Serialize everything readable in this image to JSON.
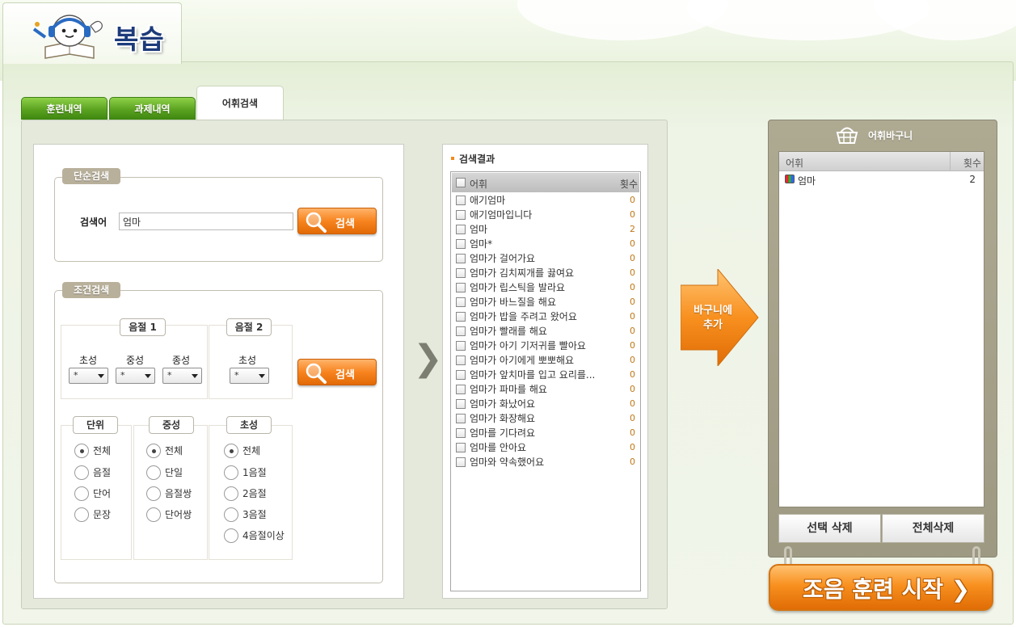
{
  "header": {
    "title": "복습"
  },
  "tabs": [
    {
      "label": "훈련내역",
      "active": false
    },
    {
      "label": "과제내역",
      "active": false
    },
    {
      "label": "어휘검색",
      "active": true
    }
  ],
  "simple_search": {
    "legend": "단순검색",
    "field_label": "검색어",
    "field_value": "엄마",
    "button_label": "검색"
  },
  "condition_search": {
    "legend": "조건검색",
    "syllable1": {
      "label": "음절 1",
      "selects": [
        {
          "label": "초성",
          "value": "*"
        },
        {
          "label": "중성",
          "value": "*"
        },
        {
          "label": "종성",
          "value": "*"
        }
      ]
    },
    "syllable2": {
      "label": "음절 2",
      "selects": [
        {
          "label": "초성",
          "value": "*"
        }
      ]
    },
    "button_label": "검색",
    "unit": {
      "label": "단위",
      "options": [
        "전체",
        "음절",
        "단어",
        "문장"
      ],
      "selected": "전체"
    },
    "middle": {
      "label": "중성",
      "options": [
        "전체",
        "단일",
        "음절쌍",
        "단어쌍"
      ],
      "selected": "전체"
    },
    "initial": {
      "label": "초성",
      "options": [
        "전체",
        "1음절",
        "2음절",
        "3음절",
        "4음절이상"
      ],
      "selected": "전체"
    }
  },
  "results": {
    "title": "검색결과",
    "col_word": "어휘",
    "col_count": "횟수",
    "rows": [
      {
        "word": "애기엄마",
        "count": "0"
      },
      {
        "word": "애기엄마입니다",
        "count": "0"
      },
      {
        "word": "엄마",
        "count": "2"
      },
      {
        "word": "엄마*",
        "count": "0"
      },
      {
        "word": "엄마가 걸어가요",
        "count": "0"
      },
      {
        "word": "엄마가 김치찌개를 끓여요",
        "count": "0"
      },
      {
        "word": "엄마가 립스틱을 발라요",
        "count": "0"
      },
      {
        "word": "엄마가 바느질을 해요",
        "count": "0"
      },
      {
        "word": "엄마가 밥을 주려고 왔어요",
        "count": "0"
      },
      {
        "word": "엄마가 빨래를 해요",
        "count": "0"
      },
      {
        "word": "엄마가 아기 기저귀를 빨아요",
        "count": "0"
      },
      {
        "word": "엄마가 아기에게 뽀뽀해요",
        "count": "0"
      },
      {
        "word": "엄마가 앞치마를 입고 요리를...",
        "count": "0"
      },
      {
        "word": "엄마가 파마를 해요",
        "count": "0"
      },
      {
        "word": "엄마가 화났어요",
        "count": "0"
      },
      {
        "word": "엄마가 화장해요",
        "count": "0"
      },
      {
        "word": "엄마를 기다려요",
        "count": "0"
      },
      {
        "word": "엄마를 안아요",
        "count": "0"
      },
      {
        "word": "엄마와 약속했어요",
        "count": "0"
      }
    ]
  },
  "add_button": {
    "line1": "바구니에",
    "line2": "추가"
  },
  "basket": {
    "title": "어휘바구니",
    "col_word": "어휘",
    "col_count": "횟수",
    "items": [
      {
        "word": "엄마",
        "count": "2"
      }
    ],
    "delete_selected": "선택 삭제",
    "delete_all": "전체삭제"
  },
  "start_button": {
    "label": "조음 훈련 시작 ❯"
  },
  "colors": {
    "tab_green": "#5aa21f",
    "accent_orange": "#f7841f",
    "basket_bg": "#aeaa92"
  }
}
